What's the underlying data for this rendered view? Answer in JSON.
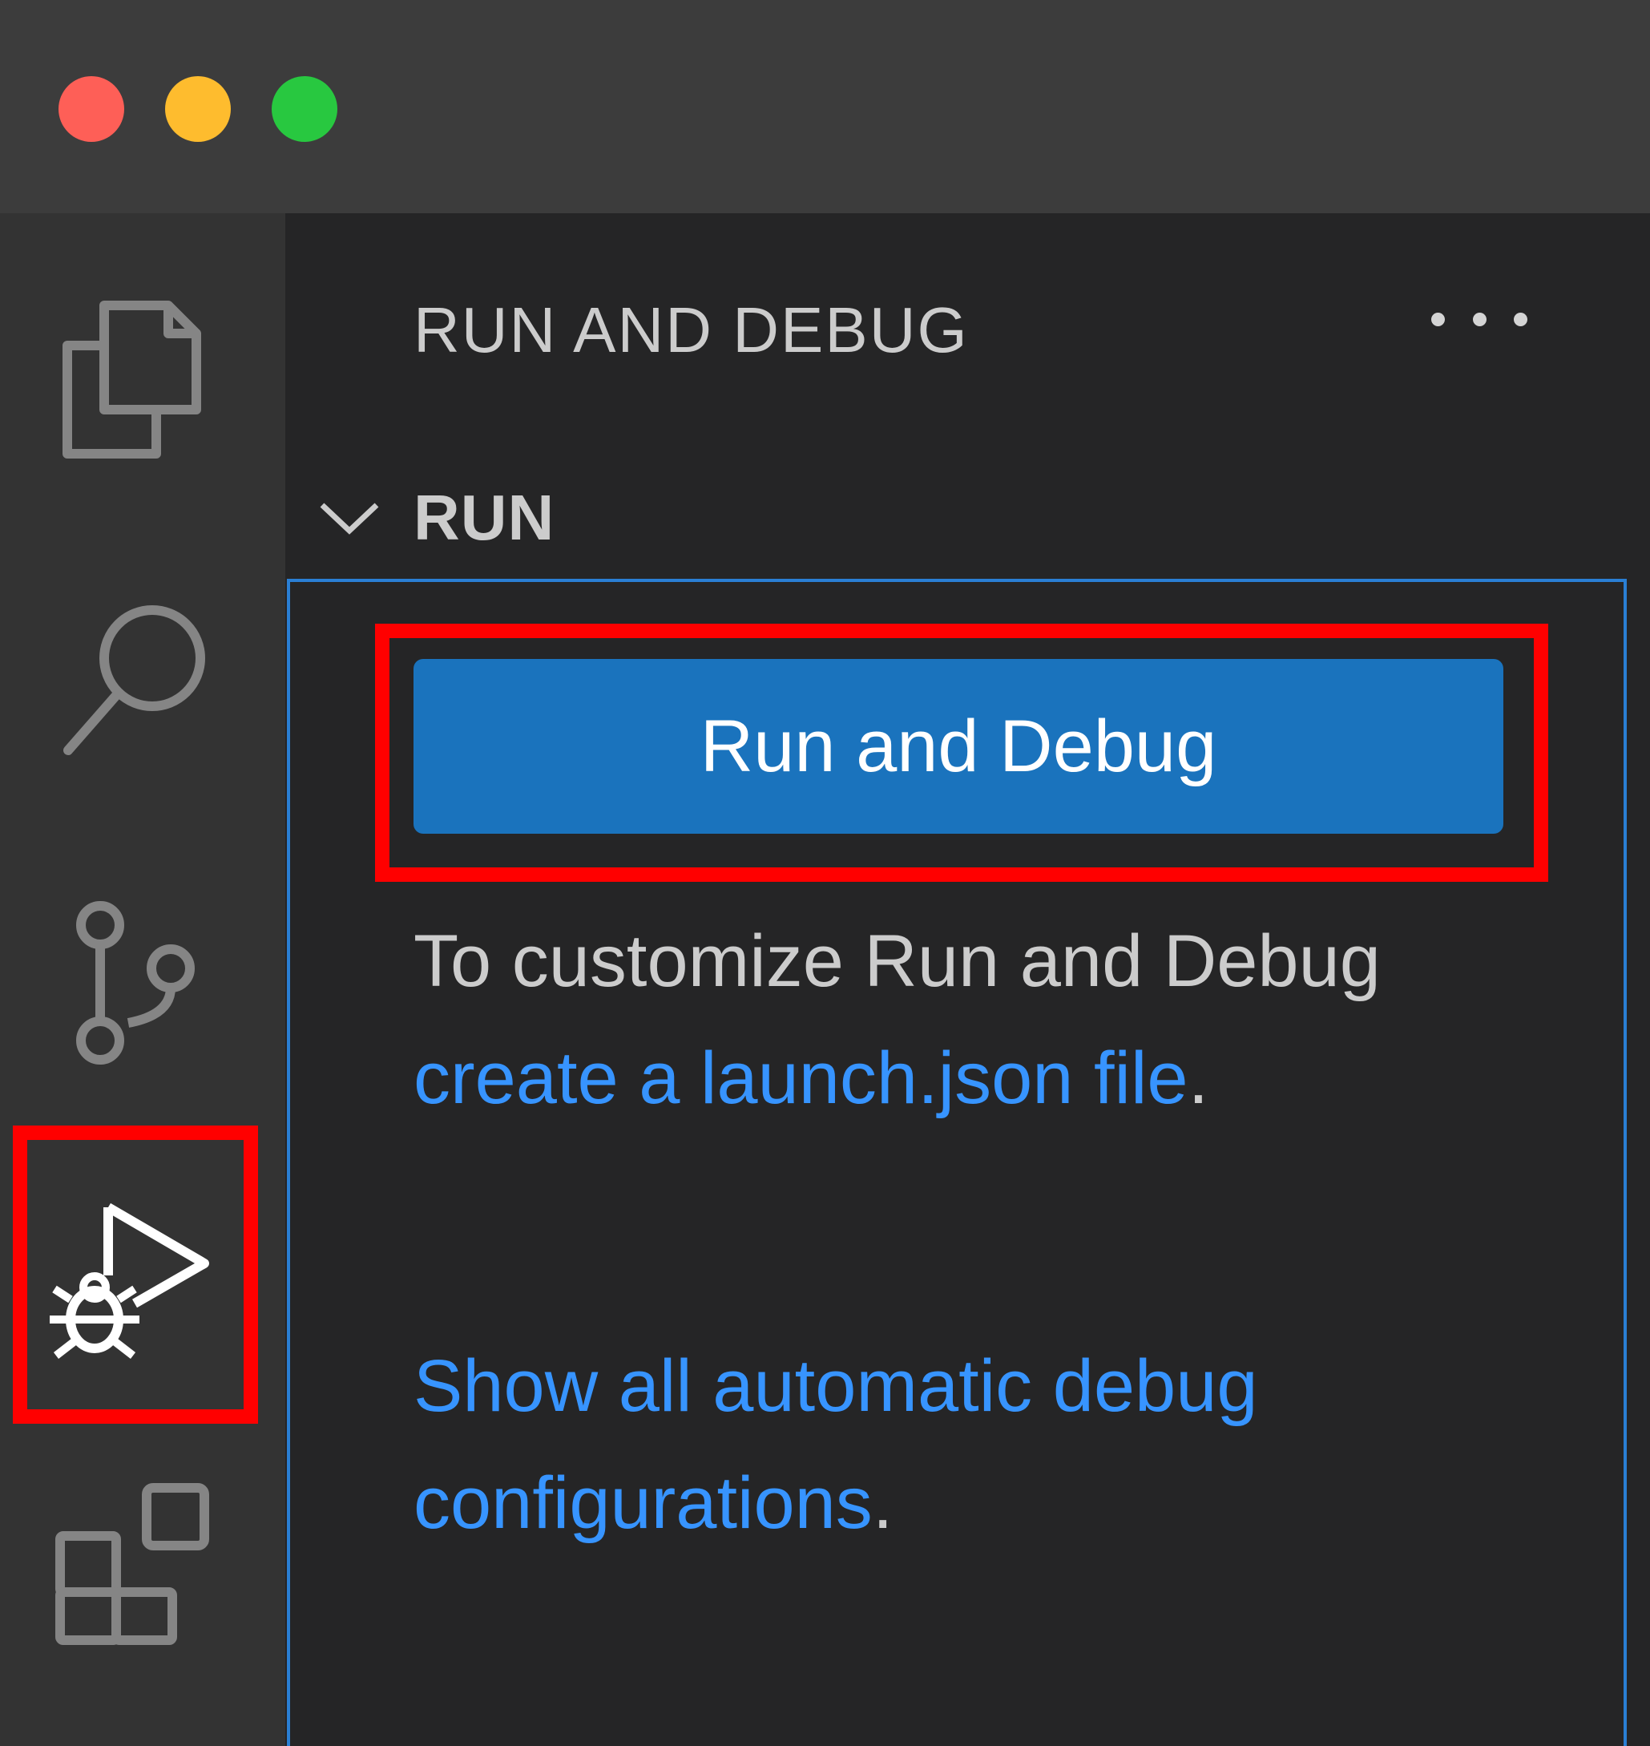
{
  "window": {
    "traffic_lights": {
      "close_color": "#fe5f57",
      "minimize_color": "#febc2e",
      "zoom_color": "#28c840"
    }
  },
  "activity_bar": {
    "items": [
      {
        "icon": "files-icon"
      },
      {
        "icon": "search-icon"
      },
      {
        "icon": "source-control-icon"
      },
      {
        "icon": "run-debug-icon",
        "active": true
      },
      {
        "icon": "extensions-icon"
      }
    ]
  },
  "sidebar": {
    "view_title": "RUN AND DEBUG",
    "more_actions_icon": "ellipsis-icon",
    "section": {
      "title": "RUN",
      "expanded": true,
      "run_button_label": "Run and Debug",
      "help": {
        "prefix": "To customize Run and Debug ",
        "link": "create a launch.json file",
        "suffix": "."
      },
      "auto": {
        "link": "Show all automatic debug configurations",
        "suffix": "."
      }
    }
  },
  "colors": {
    "button_bg": "#1a73bd",
    "link": "#3794ff",
    "highlight": "#ff0000",
    "focus_border": "#2a7fd4"
  }
}
